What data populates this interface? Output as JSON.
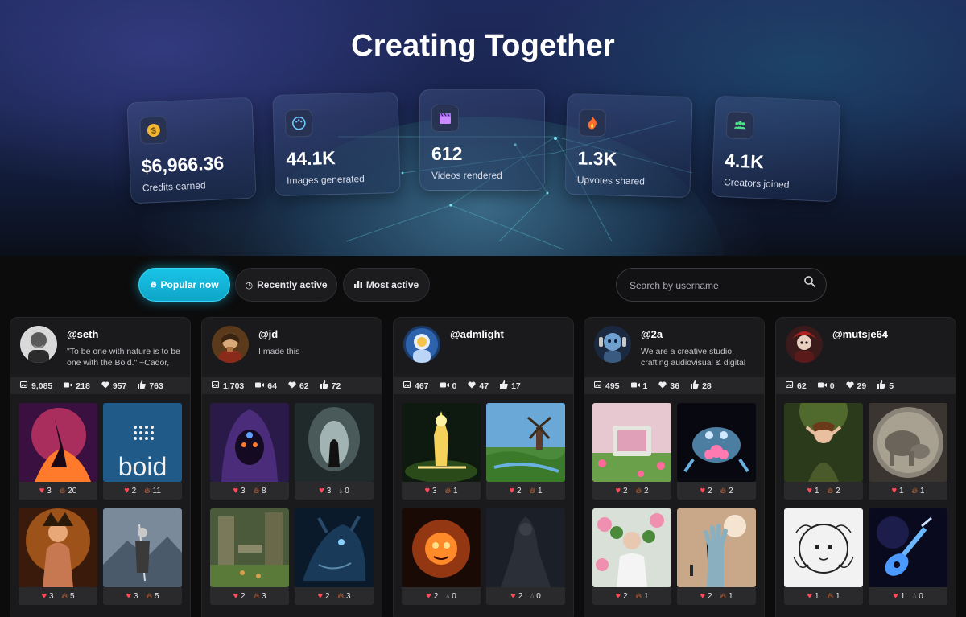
{
  "hero": {
    "title": "Creating Together",
    "stats": [
      {
        "icon": "dollar-coin-icon",
        "value": "$6,966.36",
        "label": "Credits earned"
      },
      {
        "icon": "palette-icon",
        "value": "44.1K",
        "label": "Images generated"
      },
      {
        "icon": "film-clapper-icon",
        "value": "612",
        "label": "Videos rendered"
      },
      {
        "icon": "fire-icon",
        "value": "1.3K",
        "label": "Upvotes shared"
      },
      {
        "icon": "people-group-icon",
        "value": "4.1K",
        "label": "Creators joined"
      }
    ]
  },
  "filters": {
    "tabs": [
      {
        "label": "Popular now",
        "icon": "fire-icon",
        "active": true
      },
      {
        "label": "Recently active",
        "icon": "clock-icon",
        "active": false
      },
      {
        "label": "Most active",
        "icon": "bar-chart-icon",
        "active": false
      }
    ],
    "search_placeholder": "Search by username"
  },
  "colors": {
    "accent": "#14b8dc",
    "heart": "#ff4a58",
    "fire": "#ff7a3a",
    "card_bg": "#1a1a1c"
  },
  "creators": [
    {
      "username": "@seth",
      "bio": "\"To be one with nature is to be one with the Boid.\" ~Cador,",
      "stats": {
        "images": "9,085",
        "videos": "218",
        "likes": "957",
        "upvotes": "763"
      },
      "posts": [
        {
          "likes": "3",
          "reaction": "20",
          "reaction_icon": "fire"
        },
        {
          "likes": "2",
          "reaction": "11",
          "reaction_icon": "fire"
        },
        {
          "likes": "3",
          "reaction": "5",
          "reaction_icon": "fire"
        },
        {
          "likes": "3",
          "reaction": "5",
          "reaction_icon": "fire"
        }
      ]
    },
    {
      "username": "@jd",
      "bio": "I made this",
      "stats": {
        "images": "1,703",
        "videos": "64",
        "likes": "62",
        "upvotes": "72"
      },
      "posts": [
        {
          "likes": "3",
          "reaction": "8",
          "reaction_icon": "fire"
        },
        {
          "likes": "3",
          "reaction": "0",
          "reaction_icon": "drop"
        },
        {
          "likes": "2",
          "reaction": "3",
          "reaction_icon": "fire"
        },
        {
          "likes": "2",
          "reaction": "3",
          "reaction_icon": "fire"
        }
      ]
    },
    {
      "username": "@admlight",
      "bio": "",
      "stats": {
        "images": "467",
        "videos": "0",
        "likes": "47",
        "upvotes": "17"
      },
      "posts": [
        {
          "likes": "3",
          "reaction": "1",
          "reaction_icon": "fire"
        },
        {
          "likes": "2",
          "reaction": "1",
          "reaction_icon": "fire"
        },
        {
          "likes": "2",
          "reaction": "0",
          "reaction_icon": "drop"
        },
        {
          "likes": "2",
          "reaction": "0",
          "reaction_icon": "drop"
        }
      ]
    },
    {
      "username": "@2a",
      "bio": "We are a creative studio crafting audiovisual & digital",
      "stats": {
        "images": "495",
        "videos": "1",
        "likes": "36",
        "upvotes": "28"
      },
      "posts": [
        {
          "likes": "2",
          "reaction": "2",
          "reaction_icon": "fire"
        },
        {
          "likes": "2",
          "reaction": "2",
          "reaction_icon": "fire"
        },
        {
          "likes": "2",
          "reaction": "1",
          "reaction_icon": "fire"
        },
        {
          "likes": "2",
          "reaction": "1",
          "reaction_icon": "fire"
        }
      ]
    },
    {
      "username": "@mutsje64",
      "bio": "",
      "stats": {
        "images": "62",
        "videos": "0",
        "likes": "29",
        "upvotes": "5"
      },
      "posts": [
        {
          "likes": "1",
          "reaction": "2",
          "reaction_icon": "fire"
        },
        {
          "likes": "1",
          "reaction": "1",
          "reaction_icon": "fire"
        },
        {
          "likes": "1",
          "reaction": "1",
          "reaction_icon": "fire"
        },
        {
          "likes": "1",
          "reaction": "0",
          "reaction_icon": "drop"
        }
      ]
    }
  ]
}
